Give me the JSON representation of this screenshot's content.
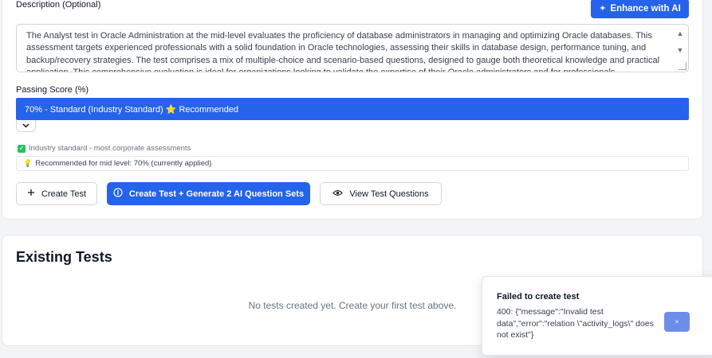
{
  "form": {
    "description_label": "Description (Optional)",
    "enhance_button": "Enhance with AI",
    "description_text": "The Analyst test in Oracle Administration at the mid-level evaluates the proficiency of database administrators in managing and optimizing Oracle databases. This assessment targets experienced professionals with a solid foundation in Oracle technologies, assessing their skills in database design, performance tuning, and backup/recovery strategies. The test comprises a mix of multiple-choice and scenario-based questions, designed to gauge both theoretical knowledge and practical application. This comprehensive evaluation is ideal for organizations looking to validate the expertise of their Oracle administrators and for professionals",
    "passing_score_label": "Passing Score (%)",
    "passing_score_selected": "70% - Standard (Industry Standard) ⭐ Recommended",
    "industry_note": "Industry standard - most corporate assessments",
    "recommendation": "Recommended for mid level: 70% (currently applied)"
  },
  "actions": {
    "create_test": "Create Test",
    "create_generate": "Create Test + Generate 2 AI Question Sets",
    "view_questions": "View Test Questions"
  },
  "existing": {
    "title": "Existing Tests",
    "empty_message": "No tests created yet. Create your first test above."
  },
  "toast": {
    "title": "Failed to create test",
    "message": "400: {\"message\":\"Invalid test data\",\"error\":\"relation \\\"activity_logs\\\" does not exist\"}",
    "close": "×"
  },
  "colors": {
    "primary": "#2563eb",
    "success": "#22c55e"
  },
  "icons": {
    "enhance": "sparkles-icon",
    "create": "plus-icon",
    "generate": "ai-brain-icon",
    "view": "eye-icon",
    "check": "check-square-icon",
    "bulb": "lightbulb-icon"
  }
}
